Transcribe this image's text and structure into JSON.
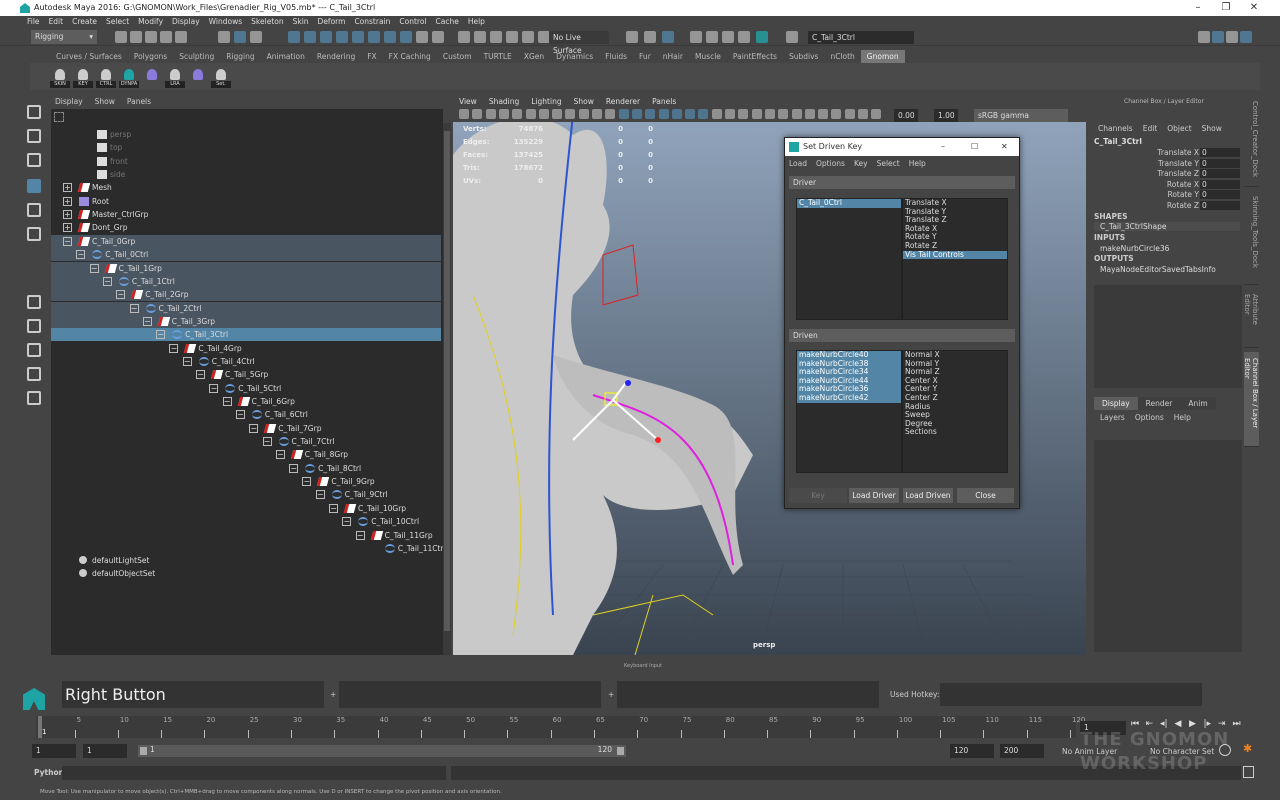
{
  "window": {
    "title": "Autodesk Maya 2016: G:\\GNOMON\\Work_Files\\Grenadier_Rig_V05.mb*  ---  C_Tail_3Ctrl",
    "minimize": "–",
    "maximize": "❐",
    "close": "✕"
  },
  "menubar": [
    "File",
    "Edit",
    "Create",
    "Select",
    "Modify",
    "Display",
    "Windows",
    "Skeleton",
    "Skin",
    "Deform",
    "Constrain",
    "Control",
    "Cache",
    "Help"
  ],
  "statusline": {
    "menuset": "Rigging",
    "live_surface": "No Live Surface",
    "name_field": "C_Tail_3Ctrl"
  },
  "shelf": {
    "tabs": [
      "Curves / Surfaces",
      "Polygons",
      "Sculpting",
      "Rigging",
      "Animation",
      "Rendering",
      "FX",
      "FX Caching",
      "Custom",
      "TURTLE",
      "XGen",
      "Dynamics",
      "Fluids",
      "Fur",
      "nHair",
      "Muscle",
      "PaintEffects",
      "Subdivs",
      "nCloth",
      "Gnomon"
    ],
    "active_tab": "Gnomon",
    "buttons": [
      "SKIN",
      "KEY",
      "CTRL",
      "DYNPA",
      "",
      "LRA",
      "",
      "Set."
    ]
  },
  "outliner": {
    "menu": [
      "Display",
      "Show",
      "Panels"
    ],
    "items": [
      {
        "label": "persp",
        "depth": 0,
        "type": "camera"
      },
      {
        "label": "top",
        "depth": 0,
        "type": "camera"
      },
      {
        "label": "front",
        "depth": 0,
        "type": "camera"
      },
      {
        "label": "side",
        "depth": 0,
        "type": "camera"
      },
      {
        "label": "Mesh",
        "depth": 0,
        "type": "group",
        "expander": "+"
      },
      {
        "label": "Root",
        "depth": 0,
        "type": "joint",
        "expander": "+"
      },
      {
        "label": "Master_CtrlGrp",
        "depth": 0,
        "type": "group",
        "expander": "+"
      },
      {
        "label": "Dont_Grp",
        "depth": 0,
        "type": "group",
        "expander": "+"
      },
      {
        "label": "C_Tail_0Grp",
        "depth": 0,
        "type": "group",
        "expander": "−",
        "hl": 1
      },
      {
        "label": "C_Tail_0Ctrl",
        "depth": 1,
        "type": "curve",
        "expander": "−",
        "hl": 1
      },
      {
        "label": "C_Tail_1Grp",
        "depth": 2,
        "type": "group",
        "expander": "−",
        "hl": 1
      },
      {
        "label": "C_Tail_1Ctrl",
        "depth": 3,
        "type": "curve",
        "expander": "−",
        "hl": 1
      },
      {
        "label": "C_Tail_2Grp",
        "depth": 4,
        "type": "group",
        "expander": "−",
        "hl": 1
      },
      {
        "label": "C_Tail_2Ctrl",
        "depth": 5,
        "type": "curve",
        "expander": "−",
        "hl": 1
      },
      {
        "label": "C_Tail_3Grp",
        "depth": 6,
        "type": "group",
        "expander": "−",
        "hl": 1
      },
      {
        "label": "C_Tail_3Ctrl",
        "depth": 7,
        "type": "curve",
        "expander": "−",
        "hl": 2
      },
      {
        "label": "C_Tail_4Grp",
        "depth": 8,
        "type": "group",
        "expander": "−"
      },
      {
        "label": "C_Tail_4Ctrl",
        "depth": 9,
        "type": "curve",
        "expander": "−"
      },
      {
        "label": "C_Tail_5Grp",
        "depth": 10,
        "type": "group",
        "expander": "−"
      },
      {
        "label": "C_Tail_5Ctrl",
        "depth": 11,
        "type": "curve",
        "expander": "−"
      },
      {
        "label": "C_Tail_6Grp",
        "depth": 12,
        "type": "group",
        "expander": "−"
      },
      {
        "label": "C_Tail_6Ctrl",
        "depth": 13,
        "type": "curve",
        "expander": "−"
      },
      {
        "label": "C_Tail_7Grp",
        "depth": 14,
        "type": "group",
        "expander": "−"
      },
      {
        "label": "C_Tail_7Ctrl",
        "depth": 15,
        "type": "curve",
        "expander": "−"
      },
      {
        "label": "C_Tail_8Grp",
        "depth": 16,
        "type": "group",
        "expander": "−"
      },
      {
        "label": "C_Tail_8Ctrl",
        "depth": 17,
        "type": "curve",
        "expander": "−"
      },
      {
        "label": "C_Tail_9Grp",
        "depth": 18,
        "type": "group",
        "expander": "−"
      },
      {
        "label": "C_Tail_9Ctrl",
        "depth": 19,
        "type": "curve",
        "expander": "−"
      },
      {
        "label": "C_Tail_10Grp",
        "depth": 20,
        "type": "group",
        "expander": "−"
      },
      {
        "label": "C_Tail_10Ctrl",
        "depth": 21,
        "type": "curve",
        "expander": "−"
      },
      {
        "label": "C_Tail_11Grp",
        "depth": 22,
        "type": "group",
        "expander": "−"
      },
      {
        "label": "C_Tail_11Ctrl",
        "depth": 23,
        "type": "curve"
      },
      {
        "label": "defaultLightSet",
        "depth": 0,
        "type": "set",
        "gap": 1
      },
      {
        "label": "defaultObjectSet",
        "depth": 0,
        "type": "set"
      }
    ]
  },
  "viewport": {
    "menu": [
      "View",
      "Shading",
      "Lighting",
      "Show",
      "Renderer",
      "Panels"
    ],
    "exposure": "0.00",
    "gamma": "1.00",
    "color_space": "sRGB gamma",
    "camera": "persp",
    "hud": [
      {
        "label": "Verts:",
        "v": [
          "74876",
          "0",
          "0"
        ]
      },
      {
        "label": "Edges:",
        "v": [
          "135229",
          "0",
          "0"
        ]
      },
      {
        "label": "Faces:",
        "v": [
          "137425",
          "0",
          "0"
        ]
      },
      {
        "label": "Tris:",
        "v": [
          "178672",
          "0",
          "0"
        ]
      },
      {
        "label": "UVs:",
        "v": [
          "0",
          "0",
          "0"
        ]
      }
    ]
  },
  "set_driven_key": {
    "title": "Set Driven Key",
    "menu": [
      "Load",
      "Options",
      "Key",
      "Select",
      "Help"
    ],
    "driver_label": "Driver",
    "driven_label": "Driven",
    "driver_objects": [
      "C_Tail_0Ctrl"
    ],
    "driver_attrs": [
      "Translate X",
      "Translate Y",
      "Translate Z",
      "Rotate X",
      "Rotate Y",
      "Rotate Z",
      "Vis Tail Controls"
    ],
    "driver_attr_selected": "Vis Tail Controls",
    "driven_objects": [
      "makeNurbCircle40",
      "makeNurbCircle38",
      "makeNurbCircle34",
      "makeNurbCircle44",
      "makeNurbCircle36",
      "makeNurbCircle42"
    ],
    "driven_attrs": [
      "Normal X",
      "Normal Y",
      "Normal Z",
      "Center X",
      "Center Y",
      "Center Z",
      "Radius",
      "Sweep",
      "Degree",
      "Sections"
    ],
    "buttons": {
      "key": "Key",
      "load_driver": "Load Driver",
      "load_driven": "Load Driven",
      "close": "Close"
    }
  },
  "channel_box": {
    "title": "Channel Box / Layer Editor",
    "menu": [
      "Channels",
      "Edit",
      "Object",
      "Show"
    ],
    "object": "C_Tail_3Ctrl",
    "channels": [
      {
        "name": "Translate X",
        "value": "0"
      },
      {
        "name": "Translate Y",
        "value": "0"
      },
      {
        "name": "Translate Z",
        "value": "0"
      },
      {
        "name": "Rotate X",
        "value": "0"
      },
      {
        "name": "Rotate Y",
        "value": "0"
      },
      {
        "name": "Rotate Z",
        "value": "0"
      }
    ],
    "shapes_label": "SHAPES",
    "shape": "C_Tail_3CtrlShape",
    "inputs_label": "INPUTS",
    "input": "makeNurbCircle36",
    "outputs_label": "OUTPUTS",
    "output": "MayaNodeEditorSavedTabsInfo",
    "layer_tabs": [
      "Display",
      "Render",
      "Anim"
    ],
    "layer_menu": [
      "Layers",
      "Options",
      "Help"
    ]
  },
  "side_tabs": [
    "Control_Creator_Dock",
    "Skinning_Tools_Dock",
    "Attribute Editor",
    "Channel Box / Layer Editor"
  ],
  "keyboard_input": {
    "title": "Keyboard Input",
    "key": "Right Button",
    "plus": "+",
    "used_hotkey_label": "Used Hotkey:"
  },
  "timeline": {
    "ticks": [
      "1",
      "5",
      "10",
      "15",
      "20",
      "25",
      "30",
      "35",
      "40",
      "45",
      "50",
      "55",
      "60",
      "65",
      "70",
      "75",
      "80",
      "85",
      "90",
      "95",
      "100",
      "105",
      "110",
      "115",
      "120"
    ],
    "current_frame": "1"
  },
  "range": {
    "start": "1",
    "playback_start": "1",
    "slider_start": "1",
    "slider_end": "120",
    "playback_end": "120",
    "end": "200",
    "anim_layer": "No Anim Layer",
    "character_set": "No Character Set"
  },
  "command_line": {
    "language": "Python"
  },
  "help_line": "Move Tool: Use manipulator to move object(s). Ctrl+MMB+drag to move components along normals. Use D or INSERT to change the pivot position and axis orientation.",
  "watermark": "THE GNOMON WORKSHOP",
  "colors": {
    "accent": "#5285a6",
    "background": "#444444",
    "field": "#2b2b2b",
    "maya_teal": "#1fa4a6"
  }
}
